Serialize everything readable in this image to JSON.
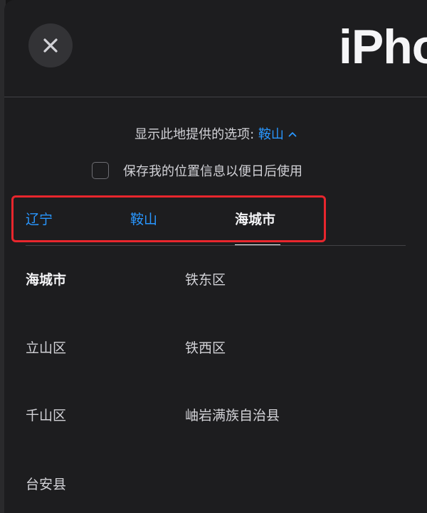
{
  "header": {
    "title": "iPho",
    "close_icon": "close-icon"
  },
  "location": {
    "prompt": "显示此地提供的选项:",
    "selected": "鞍山",
    "toggle_icon": "chevron-up-icon"
  },
  "save_location": {
    "label": "保存我的位置信息以便日后使用",
    "checked": false
  },
  "tabs": [
    {
      "label": "辽宁",
      "state": "link"
    },
    {
      "label": "鞍山",
      "state": "link"
    },
    {
      "label": "海城市",
      "state": "active"
    }
  ],
  "districts": [
    {
      "label": "海城市",
      "current": true
    },
    {
      "label": "铁东区",
      "current": false
    },
    {
      "label": "立山区",
      "current": false
    },
    {
      "label": "铁西区",
      "current": false
    },
    {
      "label": "千山区",
      "current": false
    },
    {
      "label": "岫岩满族自治县",
      "current": false
    },
    {
      "label": "台安县",
      "current": false
    }
  ],
  "colors": {
    "background": "#1d1d1f",
    "link": "#2997ff",
    "highlight_border": "#e8262d",
    "text": "#f5f5f7"
  }
}
